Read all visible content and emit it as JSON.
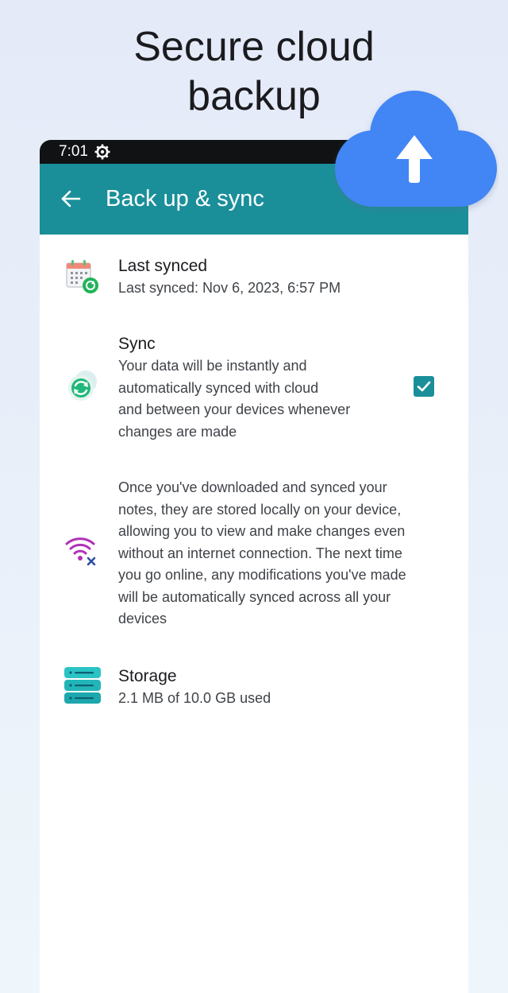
{
  "promo": {
    "headline": "Secure cloud\nbackup"
  },
  "status_bar": {
    "time": "7:01"
  },
  "app_bar": {
    "title": "Back up & sync"
  },
  "settings": {
    "last_synced": {
      "title": "Last synced",
      "subtitle": "Last synced: Nov 6, 2023, 6:57 PM"
    },
    "sync": {
      "title": "Sync",
      "subtitle": "Your data will be instantly and\nautomatically synced with cloud\nand between your devices whenever\nchanges are made",
      "checked": true
    },
    "offline": {
      "subtitle": "Once you've downloaded and synced your\nnotes, they are stored locally on your device,\nallowing you to view and make changes even\nwithout an internet connection. The next time\nyou go online, any modifications you've made\nwill be automatically synced across all your\ndevices"
    },
    "storage": {
      "title": "Storage",
      "subtitle": "2.1 MB of 10.0 GB used"
    }
  },
  "colors": {
    "app_bar": "#1a8f9a",
    "status_bar": "#101214",
    "cloud": "#4285f4",
    "checkbox": "#1a8f9a"
  },
  "icons": {
    "status": "settings-gear-icon",
    "back": "arrow-back-icon",
    "last_synced": "calendar-sync-icon",
    "sync": "sync-icon",
    "offline": "wifi-off-icon",
    "storage": "storage-icon",
    "cloud": "cloud-upload-icon",
    "checkbox": "checkmark-icon"
  }
}
